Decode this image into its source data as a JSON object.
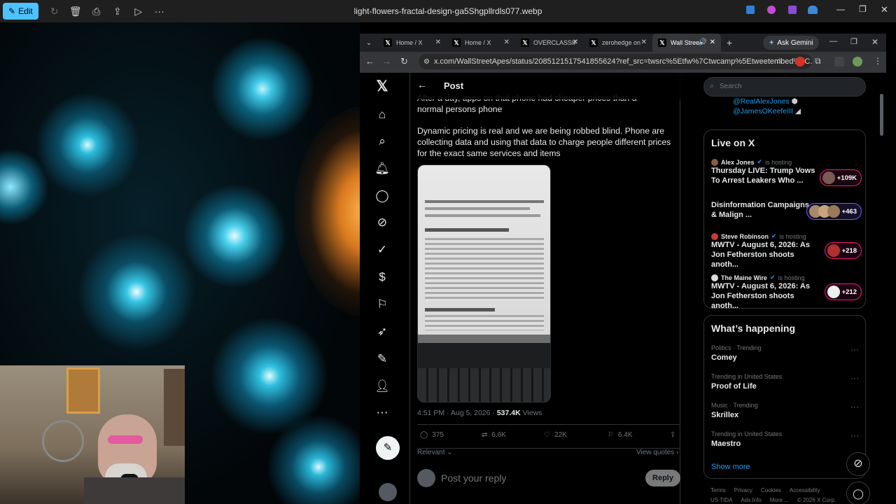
{
  "viewer": {
    "edit_label": "Edit",
    "file_name": "light-flowers-fractal-design-ga5Shgpllrdls077.webp"
  },
  "browser": {
    "tabs": [
      {
        "label": "Home / X"
      },
      {
        "label": "Home / X"
      },
      {
        "label": "OVERCLASSIF"
      },
      {
        "label": "zerohedge on"
      },
      {
        "label": "Wall Stree"
      }
    ],
    "ask_gemini": "Ask Gemini",
    "url": "x.com/WallStreetApes/status/2085121517541855624?ref_src=twsrc%5Etfw%7Ctwcamp%5Etweetembed%7C..."
  },
  "post": {
    "header": "Post",
    "text_top": "After a day, apps on that phone had cheaper prices than a normal persons phone",
    "text_main": "Dynamic pricing is real and we are being robbed blind. Phone are collecting data and using that data to charge people different prices for the exact same services and items",
    "meta_time": "4:51 PM · Aug 5, 2026 · ",
    "views_count": "537.4K",
    "views_label": " Views",
    "replies": "375",
    "reposts": "6.6K",
    "likes": "22K",
    "bookmarks": "6.4K",
    "relevant": "Relevant",
    "view_quotes": "View quotes",
    "reply_placeholder": "Post your reply",
    "reply_button": "Reply"
  },
  "right": {
    "search_placeholder": "Search",
    "mentions": [
      "@RealAlexJones",
      "@JamesOKeefeIII"
    ],
    "live_title": "Live on X",
    "live": [
      {
        "host": "Alex Jones",
        "status": "is hosting",
        "title": "Thursday LIVE: Trump Vows To Arrest Leakers Who ...",
        "count": "+109K"
      },
      {
        "host": "",
        "status": "",
        "title": "Disinformation Campaigns & Malign ...",
        "count": "+463"
      },
      {
        "host": "Steve Robinson",
        "status": "is hosting",
        "title": "MWTV - August 6, 2026: As Jon Fetherston shoots anoth...",
        "count": "+218"
      },
      {
        "host": "The Maine Wire",
        "status": "is hosting",
        "title": "MWTV - August 6, 2026: As Jon Fetherston shoots anoth...",
        "count": "+212"
      }
    ],
    "happening_title": "What’s happening",
    "trends": [
      {
        "category": "Politics · Trending",
        "name": "Comey"
      },
      {
        "category": "Trending in United States",
        "name": "Proof of Life"
      },
      {
        "category": "Music · Trending",
        "name": "Skrillex"
      },
      {
        "category": "Trending in United States",
        "name": "Maestro"
      }
    ],
    "show_more": "Show more",
    "footer_links": [
      "Terms",
      "Privacy",
      "Cookies",
      "Accessibility"
    ],
    "footer_links2": [
      "US TIDA",
      "Ads Info",
      "More ...",
      "© 2026 X Corp."
    ]
  },
  "colors": {
    "accent": "#1d9bf0",
    "live_pill": "#f91880",
    "edit_button": "#4cc2ff"
  }
}
